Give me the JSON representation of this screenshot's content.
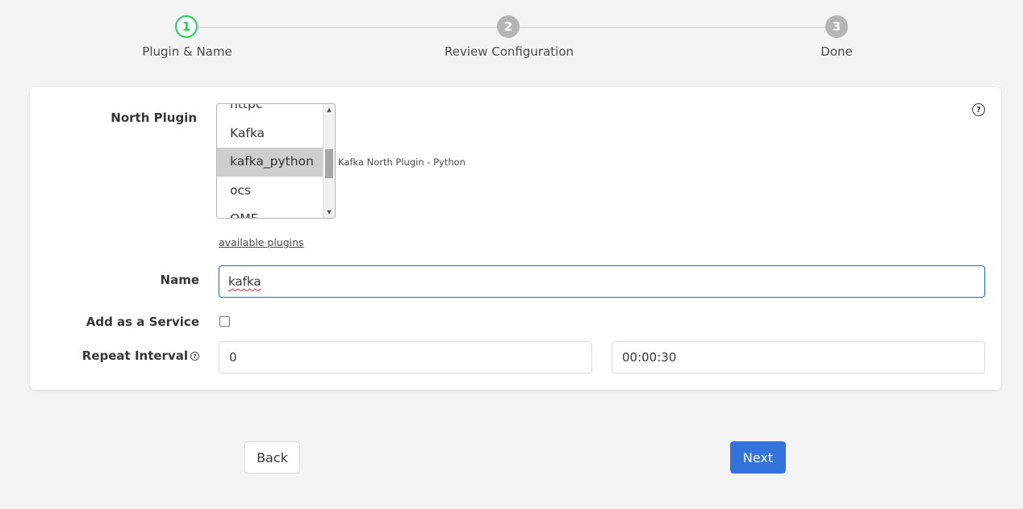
{
  "stepper": {
    "steps": [
      {
        "number": "1",
        "label": "Plugin & Name",
        "state": "active"
      },
      {
        "number": "2",
        "label": "Review Configuration",
        "state": "inactive"
      },
      {
        "number": "3",
        "label": "Done",
        "state": "inactive"
      }
    ],
    "active_color": "#23d160",
    "inactive_color": "#b5b5b5"
  },
  "form": {
    "help_icon": "question-circle-icon",
    "north_plugin": {
      "label": "North Plugin",
      "options": [
        "httpc",
        "Kafka",
        "kafka_python",
        "ocs",
        "OMF"
      ],
      "selected": "kafka_python",
      "description": "Kafka North Plugin - Python",
      "available_link": "available plugins"
    },
    "name": {
      "label": "Name",
      "value": "kafka"
    },
    "service": {
      "label": "Add as a Service",
      "checked": false
    },
    "repeat_interval": {
      "label": "Repeat Interval",
      "days_value": "0",
      "time_value": "00:00:30"
    }
  },
  "buttons": {
    "back": "Back",
    "next": "Next",
    "primary_color": "#3273dc"
  }
}
